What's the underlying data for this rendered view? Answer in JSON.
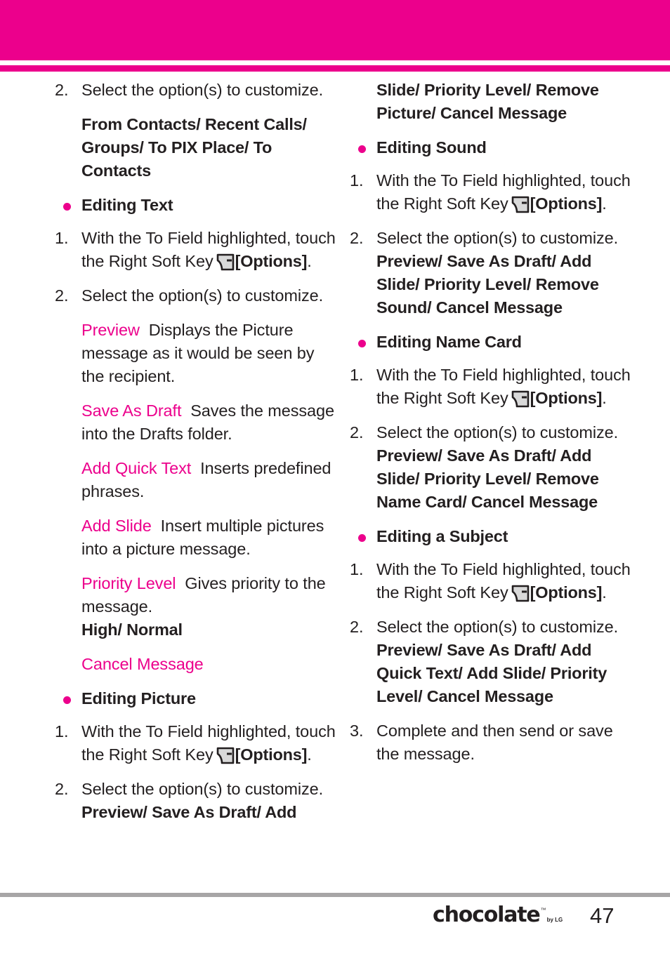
{
  "theme": {
    "accent": "#ec008c",
    "text": "#231f20",
    "rule": "#a7a5a6"
  },
  "header": {
    "band_label": "pink-header-band",
    "stripe_label": "pink-header-stripe"
  },
  "icons": {
    "right_soft_key": "right-soft-key-icon"
  },
  "left_column": {
    "step_2_top": {
      "number": "2.",
      "text": "Select the option(s) to customize."
    },
    "options_from_contacts": "From Contacts/ Recent Calls/ Groups/ To PIX Place/ To Contacts",
    "editing_text_heading": "Editing Text",
    "text_step_1": {
      "number": "1.",
      "before_icon": "With the To Field highlighted, touch the Right Soft Key",
      "after_icon_bold": "[Options]",
      "after_icon_tail": "."
    },
    "text_step_2": {
      "number": "2.",
      "text": "Select the option(s) to customize."
    },
    "definitions": [
      {
        "term": "Preview",
        "description": "Displays the Picture message as it would be seen by the recipient."
      },
      {
        "term": "Save As Draft",
        "description": "Saves the message into the Drafts folder."
      },
      {
        "term": "Add Quick Text",
        "description": "Inserts predefined phrases."
      },
      {
        "term": "Add Slide",
        "description": "Insert multiple pictures into a picture message."
      },
      {
        "term": "Priority Level",
        "description": "Gives priority to the message.",
        "values": "High/ Normal"
      },
      {
        "term": "Cancel Message",
        "description": ""
      }
    ],
    "editing_picture_heading": "Editing Picture",
    "picture_step_1": {
      "number": "1.",
      "before_icon": "With the To Field highlighted, touch the Right Soft Key",
      "after_icon_bold": "[Options]",
      "after_icon_tail": "."
    },
    "picture_step_2": {
      "number": "2.",
      "text": "Select the option(s) to customize.",
      "options": "Preview/ Save As Draft/ Add"
    }
  },
  "right_column": {
    "options_continued": "Slide/ Priority Level/ Remove Picture/ Cancel Message",
    "editing_sound_heading": "Editing Sound",
    "sound_step_1": {
      "number": "1.",
      "before_icon": "With the To Field highlighted, touch the Right Soft Key",
      "after_icon_bold": "[Options]",
      "after_icon_tail": "."
    },
    "sound_step_2": {
      "number": "2.",
      "text": "Select the option(s) to customize.",
      "options": "Preview/ Save As Draft/ Add Slide/ Priority Level/ Remove Sound/ Cancel Message"
    },
    "editing_name_card_heading": "Editing Name Card",
    "name_card_step_1": {
      "number": "1.",
      "before_icon": "With the To Field highlighted, touch the Right Soft Key",
      "after_icon_bold": "[Options]",
      "after_icon_tail": "."
    },
    "name_card_step_2": {
      "number": "2.",
      "text": "Select the option(s) to customize.",
      "options": "Preview/ Save As Draft/ Add Slide/ Priority Level/ Remove Name Card/ Cancel Message"
    },
    "editing_subject_heading": "Editing a Subject",
    "subject_step_1": {
      "number": "1.",
      "before_icon": "With the To Field highlighted, touch the Right Soft Key",
      "after_icon_bold": "[Options]",
      "after_icon_tail": "."
    },
    "subject_step_2": {
      "number": "2.",
      "text": "Select the option(s) to customize.",
      "options": "Preview/ Save As Draft/ Add Quick Text/ Add Slide/ Priority Level/ Cancel Message"
    },
    "subject_step_3": {
      "number": "3.",
      "text": "Complete and then send or save the message."
    }
  },
  "footer": {
    "logo_text": "chocolate",
    "logo_tm": "™",
    "logo_by": "by LG",
    "page_number": "47"
  }
}
